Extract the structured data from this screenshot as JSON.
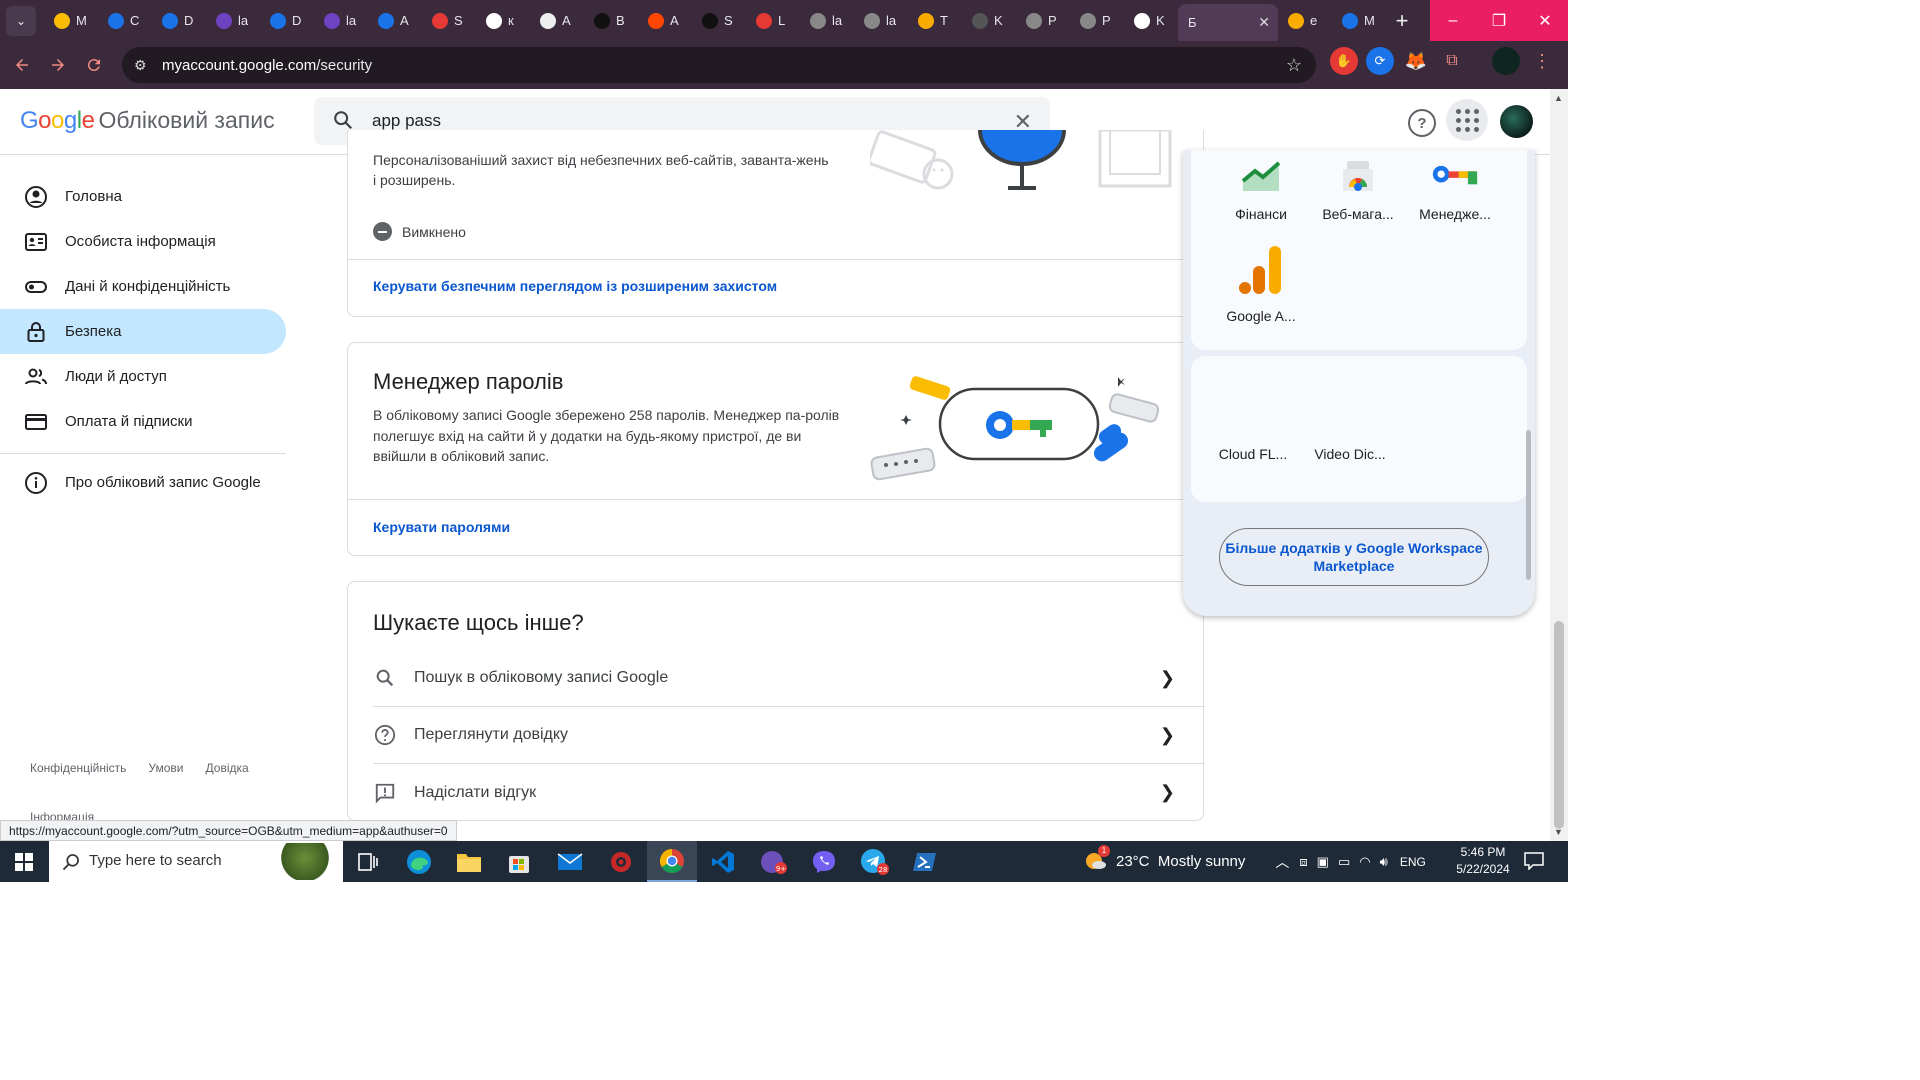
{
  "browser": {
    "tabs": [
      {
        "label": "M",
        "icon": "google-drive-icon",
        "color": "#fbbc04"
      },
      {
        "label": "C",
        "icon": "c-app-icon",
        "color": "#1a73e8"
      },
      {
        "label": "D",
        "icon": "c-app-icon",
        "color": "#1a73e8"
      },
      {
        "label": "la",
        "icon": "spiral-icon",
        "color": "#6f42c1"
      },
      {
        "label": "D",
        "icon": "c-app-icon",
        "color": "#1a73e8"
      },
      {
        "label": "la",
        "icon": "spiral-icon",
        "color": "#6f42c1"
      },
      {
        "label": "A",
        "icon": "c-app-icon",
        "color": "#1a73e8"
      },
      {
        "label": "S",
        "icon": "flame-icon",
        "color": "#e53935"
      },
      {
        "label": "к",
        "icon": "google-icon",
        "color": "#ffffff"
      },
      {
        "label": "A",
        "icon": "triangle-logo-icon",
        "color": "#eeeeee"
      },
      {
        "label": "B",
        "icon": "openai-icon",
        "color": "#111111"
      },
      {
        "label": "A",
        "icon": "reddit-icon",
        "color": "#ff4500"
      },
      {
        "label": "S",
        "icon": "openai-icon",
        "color": "#111111"
      },
      {
        "label": "L",
        "icon": "flame-icon",
        "color": "#e53935"
      },
      {
        "label": "la",
        "icon": "globe-icon",
        "color": "#888888"
      },
      {
        "label": "la",
        "icon": "globe-icon",
        "color": "#888888"
      },
      {
        "label": "T",
        "icon": "warning-logo-icon",
        "color": "#f9ab00"
      },
      {
        "label": "K",
        "icon": "grok-icon",
        "color": "#555555"
      },
      {
        "label": "P",
        "icon": "globe-icon",
        "color": "#888888"
      },
      {
        "label": "P",
        "icon": "globe-icon",
        "color": "#888888"
      },
      {
        "label": "K",
        "icon": "openai-icon",
        "color": "#ffffff"
      },
      {
        "label": "Б",
        "icon": "none",
        "color": "#523b57",
        "active": true
      },
      {
        "label": "e",
        "icon": "analytics-icon",
        "color": "#f9ab00"
      },
      {
        "label": "M",
        "icon": "search-icon",
        "color": "#1a73e8"
      }
    ],
    "url_domain": "myaccount.google.com",
    "url_path": "/security",
    "status_url": "https://myaccount.google.com/?utm_source=OGB&utm_medium=app&authuser=0"
  },
  "header": {
    "logo": "Google",
    "title": "Обліковий запис",
    "search_value": "app pass"
  },
  "sidebar": {
    "items": [
      {
        "label": "Головна",
        "icon": "account-circle-icon"
      },
      {
        "label": "Особиста інформація",
        "icon": "id-card-icon"
      },
      {
        "label": "Дані й конфіденційність",
        "icon": "toggle-icon"
      },
      {
        "label": "Безпека",
        "icon": "lock-icon",
        "active": true
      },
      {
        "label": "Люди й доступ",
        "icon": "people-icon"
      },
      {
        "label": "Оплата й підписки",
        "icon": "credit-card-icon"
      }
    ],
    "about": "Про обліковий запис Google",
    "footer": [
      "Конфіденційність",
      "Умови",
      "Довідка"
    ],
    "footer_info": "Інформація"
  },
  "safe_browsing": {
    "desc": "Персоналізованіший захист від небезпечних веб-сайтів, заванта-жень і розширень.",
    "status": "Вимкнено",
    "link": "Керувати безпечним переглядом із розширеним захистом"
  },
  "password_manager": {
    "title": "Менеджер паролів",
    "desc": "В обліковому записі Google збережено 258 паролів. Менеджер па-ролів полегшує вхід на сайти й у додатки на будь-якому пристрої, де ви ввійшли в обліковий запис.",
    "link": "Керувати паролями"
  },
  "something_else": {
    "title": "Шукаєте щось інше?",
    "rows": [
      {
        "label": "Пошук в обліковому записі Google",
        "icon": "search-icon"
      },
      {
        "label": "Переглянути довідку",
        "icon": "help-icon"
      },
      {
        "label": "Надіслати відгук",
        "icon": "feedback-icon"
      }
    ]
  },
  "apps_panel": {
    "apps": [
      {
        "label": "Фінанси",
        "icon": "finance-icon"
      },
      {
        "label": "Веб-мага...",
        "icon": "web-store-icon"
      },
      {
        "label": "Менедже...",
        "icon": "password-manager-icon"
      },
      {
        "label": "Google A...",
        "icon": "analytics-icon"
      }
    ],
    "workspace_apps": [
      {
        "label": "Cloud FL..."
      },
      {
        "label": "Video Dic..."
      }
    ],
    "more_button": "Більше додатків у Google Workspace Marketplace"
  },
  "taskbar": {
    "search_placeholder": "Type here to search",
    "weather": "23°C  Mostly sunny",
    "language": "ENG",
    "time": "5:46 PM",
    "date": "5/22/2024",
    "badge_count_1": "9+",
    "badge_count_2": "28",
    "weather_badge": "1"
  }
}
